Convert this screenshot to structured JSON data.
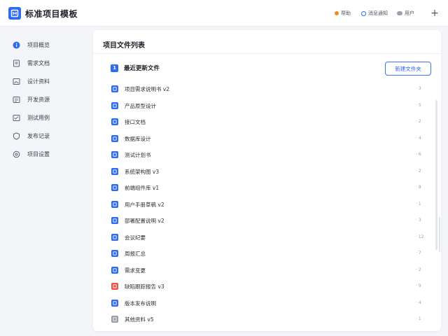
{
  "header": {
    "app_title": "标准项目模板",
    "items": [
      {
        "label": "帮助",
        "dot_color": "#f08a24"
      },
      {
        "label": "消息通知",
        "dot_color": "#2f6bf0"
      },
      {
        "label": "用户",
        "dot_color": "#9aa1ad"
      }
    ],
    "plus_icon": "plus-icon",
    "plus_glyph": "+"
  },
  "sidebar": {
    "items": [
      {
        "label": "项目概览",
        "icon": "info-circle-icon",
        "color": "#2f6bf0"
      },
      {
        "label": "需求文档",
        "icon": "document-icon",
        "color": "#5b6270"
      },
      {
        "label": "设计资料",
        "icon": "image-icon",
        "color": "#5b6270"
      },
      {
        "label": "开发资源",
        "icon": "list-icon",
        "color": "#5b6270"
      },
      {
        "label": "测试用例",
        "icon": "checklist-icon",
        "color": "#5b6270"
      },
      {
        "label": "发布记录",
        "icon": "shield-icon",
        "color": "#5b6270"
      },
      {
        "label": "项目设置",
        "icon": "settings-icon",
        "color": "#5b6270"
      }
    ]
  },
  "main": {
    "title": "项目文件列表",
    "section": {
      "badge": "1",
      "title": "最近更新文件",
      "create_button": "新建文件夹"
    },
    "rows": [
      {
        "label": "项目需求说明书 v2",
        "meta": "· 3",
        "icon": "blue-file",
        "color": "#2f6bf0"
      },
      {
        "label": "产品原型设计",
        "meta": "· 5",
        "icon": "blue-file",
        "color": "#2f6bf0"
      },
      {
        "label": "接口文档",
        "meta": "· 2",
        "icon": "blue-file",
        "color": "#2f6bf0"
      },
      {
        "label": "数据库设计",
        "meta": "· 4",
        "icon": "blue-file",
        "color": "#2f6bf0"
      },
      {
        "label": "测试计划书",
        "meta": "· 6",
        "icon": "blue-file",
        "color": "#2f6bf0"
      },
      {
        "label": "系统架构图 v3",
        "meta": "· 2",
        "icon": "blue-file",
        "color": "#2f6bf0"
      },
      {
        "label": "前端组件库 v1",
        "meta": "· 8",
        "icon": "blue-file",
        "color": "#2f6bf0"
      },
      {
        "label": "用户手册草稿 v2",
        "meta": "· 1",
        "icon": "blue-file",
        "color": "#2f6bf0"
      },
      {
        "label": "部署配置说明 v2",
        "meta": "· 3",
        "icon": "blue-file",
        "color": "#2f6bf0"
      },
      {
        "label": "会议纪要",
        "meta": "· 12",
        "icon": "blue-file",
        "color": "#2f6bf0"
      },
      {
        "label": "周报汇总",
        "meta": "· 7",
        "icon": "blue-file",
        "color": "#2f6bf0"
      },
      {
        "label": "需求变更",
        "meta": "· 2",
        "icon": "blue-file",
        "color": "#2f6bf0"
      },
      {
        "label": "缺陷跟踪报告 v3",
        "meta": "· 9",
        "icon": "red-file",
        "color": "#e8564a"
      },
      {
        "label": "版本发布说明",
        "meta": "· 4",
        "icon": "blue-file",
        "color": "#2f6bf0"
      },
      {
        "label": "其他资料 v5",
        "meta": "· 1",
        "icon": "gray-file",
        "color": "#9aa1ad"
      }
    ]
  }
}
